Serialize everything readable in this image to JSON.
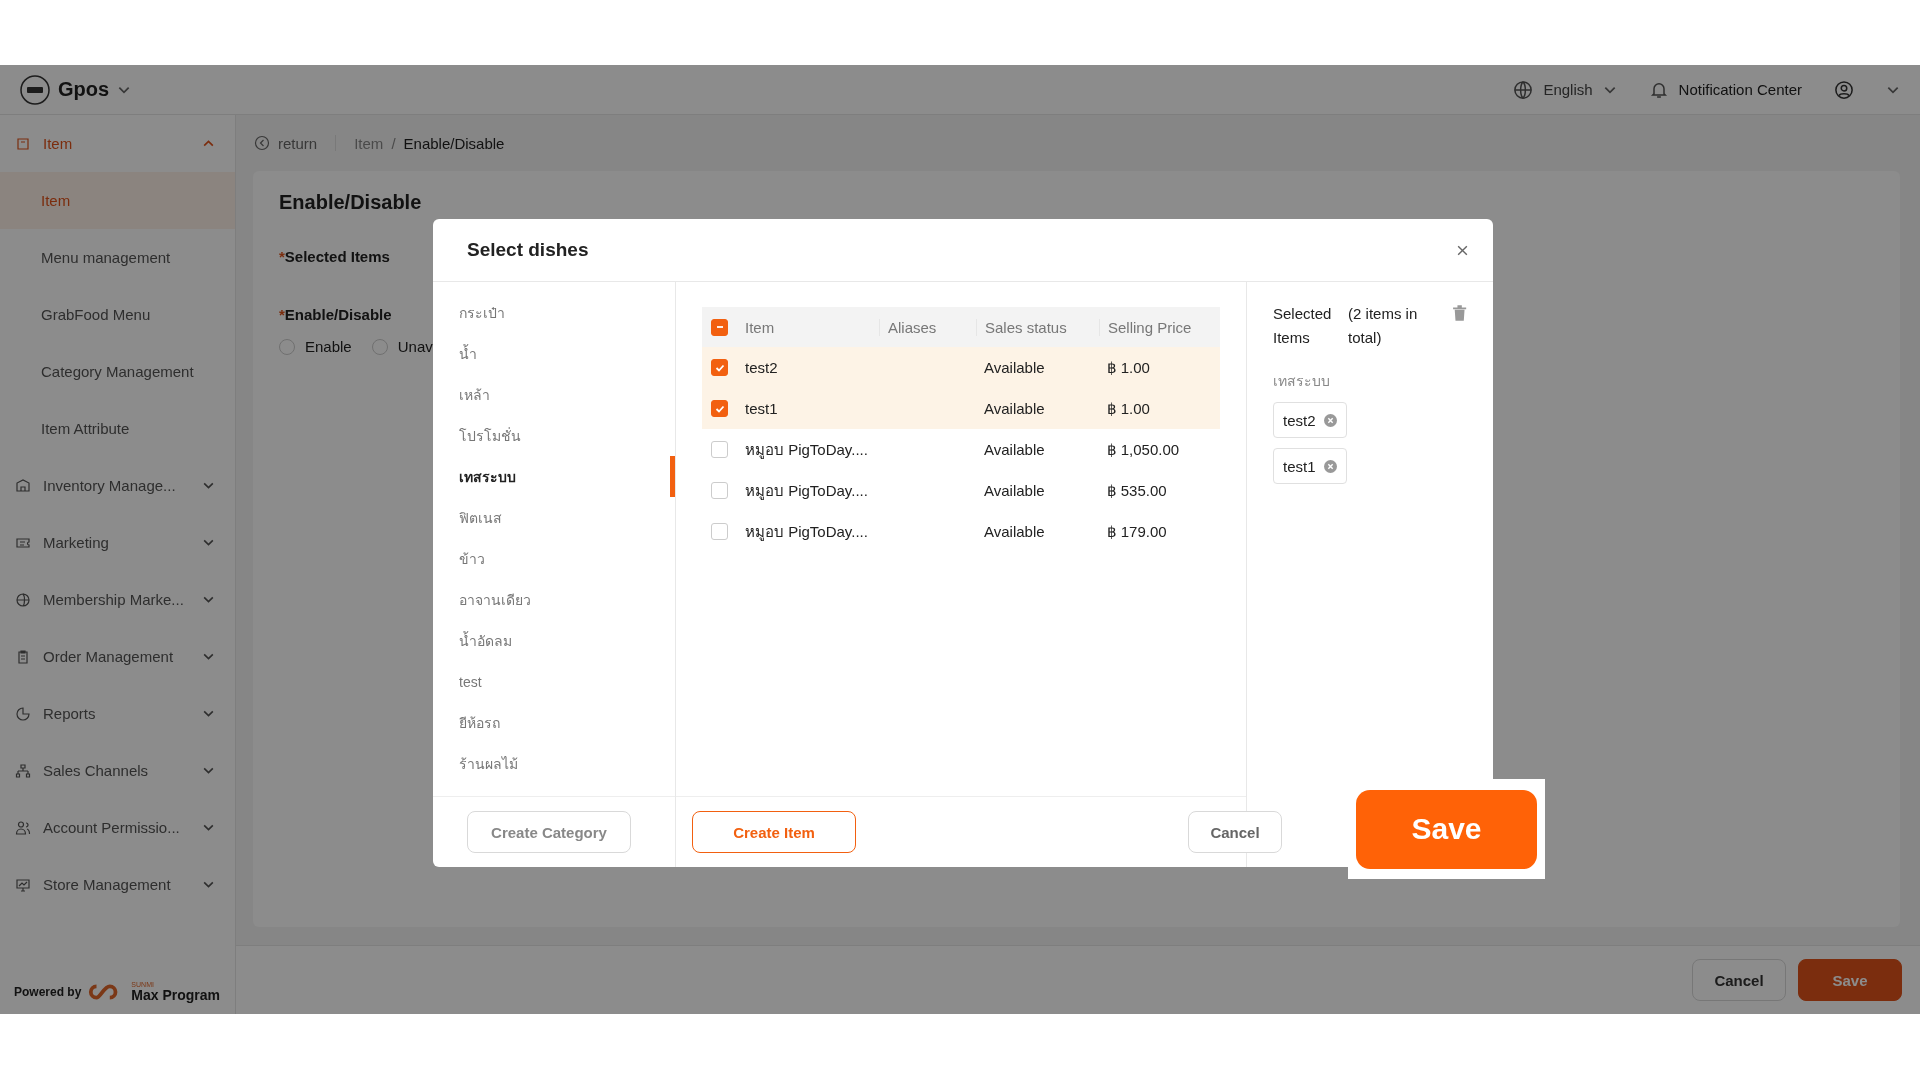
{
  "header": {
    "brand": "Gpos",
    "language": "English",
    "notification": "Notification Center"
  },
  "sidebar": {
    "items": [
      {
        "label": "Item",
        "expanded": true,
        "children": [
          {
            "label": "Item",
            "selected": true
          },
          {
            "label": "Menu management",
            "selected": false
          },
          {
            "label": "GrabFood Menu",
            "selected": false
          },
          {
            "label": "Category Management",
            "selected": false
          },
          {
            "label": "Item Attribute",
            "selected": false
          }
        ]
      },
      {
        "label": "Inventory Manage...",
        "expanded": false
      },
      {
        "label": "Marketing",
        "expanded": false
      },
      {
        "label": "Membership Marke...",
        "expanded": false
      },
      {
        "label": "Order Management",
        "expanded": false
      },
      {
        "label": "Reports",
        "expanded": false
      },
      {
        "label": "Sales Channels",
        "expanded": false
      },
      {
        "label": "Account Permissio...",
        "expanded": false
      },
      {
        "label": "Store Management",
        "expanded": false
      }
    ],
    "footer": {
      "powered_by": "Powered by",
      "maker_small": "SUNMI",
      "maker": "Max Program"
    }
  },
  "breadcrumb": {
    "back": "return",
    "path": [
      "Item",
      "Enable/Disable"
    ],
    "separator": "/"
  },
  "page": {
    "title": "Enable/Disable",
    "fields": [
      {
        "required_mark": "*",
        "label": "Selected Items"
      },
      {
        "required_mark": "*",
        "label": "Enable/Disable"
      }
    ],
    "radios": [
      {
        "label": "Enable",
        "selected": false
      },
      {
        "label": "Unav",
        "selected": false
      }
    ],
    "buttons": [
      "Cancel",
      "Save"
    ]
  },
  "modal": {
    "title": "Select dishes",
    "categories": [
      {
        "label": "กระเป๋า",
        "selected": false
      },
      {
        "label": "น้ำ",
        "selected": false
      },
      {
        "label": "เหล้า",
        "selected": false
      },
      {
        "label": "โปรโมชั่น",
        "selected": false
      },
      {
        "label": "เทสระบบ",
        "selected": true
      },
      {
        "label": "ฟิตเนส",
        "selected": false
      },
      {
        "label": "ข้าว",
        "selected": false
      },
      {
        "label": "อาจานเดียว",
        "selected": false
      },
      {
        "label": "น้ำอัดลม",
        "selected": false
      },
      {
        "label": "test",
        "selected": false
      },
      {
        "label": "ยีห้อรถ",
        "selected": false
      },
      {
        "label": "ร้านผลไม้",
        "selected": false
      }
    ],
    "table": {
      "select_all_indeterminate": true,
      "columns": [
        "Item",
        "Aliases",
        "Sales status",
        "Selling Price"
      ],
      "rows": [
        {
          "item": "test2",
          "status": "Available",
          "price": "฿ 1.00",
          "checked": true
        },
        {
          "item": "test1",
          "status": "Available",
          "price": "฿ 1.00",
          "checked": true
        },
        {
          "item": "หมูอบ PigToDay....",
          "status": "Available",
          "price": "฿ 1,050.00",
          "checked": false
        },
        {
          "item": "หมูอบ PigToDay....",
          "status": "Available",
          "price": "฿ 535.00",
          "checked": false
        },
        {
          "item": "หมูอบ PigToDay....",
          "status": "Available",
          "price": "฿ 179.00",
          "checked": false
        }
      ]
    },
    "selected_panel": {
      "title": "Selected Items",
      "count": "(2 items in total)",
      "group": "เทสระบบ",
      "tags": [
        "test2",
        "test1"
      ]
    },
    "footer": {
      "create_category": "Create Category",
      "create_item": "Create Item",
      "cancel": "Cancel",
      "save": "Save"
    }
  }
}
